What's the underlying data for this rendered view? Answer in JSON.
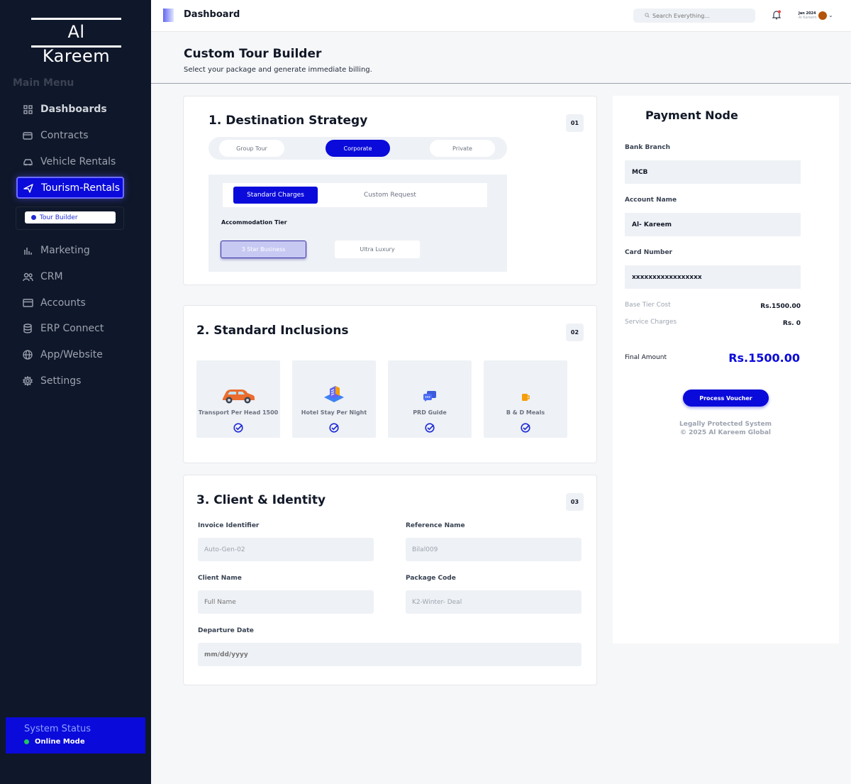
{
  "brand": "Al Kareem",
  "sidebar": {
    "menu_heading": "Main Menu",
    "items": [
      {
        "label": "Dashboards"
      },
      {
        "label": "Contracts"
      },
      {
        "label": "Vehicle Rentals"
      },
      {
        "label": "Tourism-Rentals"
      },
      {
        "label": "Marketing"
      },
      {
        "label": "CRM"
      },
      {
        "label": "Accounts"
      },
      {
        "label": "ERP Connect"
      },
      {
        "label": "App/Website"
      },
      {
        "label": "Settings"
      }
    ],
    "sub_item": "Tour Builder",
    "status_title": "System Status",
    "status_value": "Online Mode"
  },
  "topbar": {
    "title": "Dashboard",
    "search_placeholder": "Search Everything...",
    "user_date": "Jan 2024",
    "user_name": "Al Kareem"
  },
  "page": {
    "title": "Custom Tour Builder",
    "subtitle": "Select your package and generate immediate billing."
  },
  "destination": {
    "title": "1. Destination Strategy",
    "badge": "01",
    "modes": [
      "Group Tour",
      "Corporate",
      "Private"
    ],
    "tabs": [
      "Standard Charges",
      "Custom Request"
    ],
    "accommodation_label": "Accommodation Tier",
    "tiers": [
      "3 Star Business",
      "Ultra Luxury"
    ]
  },
  "inclusions": {
    "title": "2. Standard Inclusions",
    "badge": "02",
    "items": [
      {
        "label": "Transport Per Head 1500",
        "icon": "car-icon"
      },
      {
        "label": "Hotel Stay Per Night",
        "icon": "hotel-icon"
      },
      {
        "label": "PRD Guide",
        "icon": "guide-chat-icon"
      },
      {
        "label": "B & D Meals",
        "icon": "mug-icon"
      }
    ]
  },
  "client": {
    "title": "3. Client & Identity",
    "badge": "03",
    "invoice_label": "Invoice Identifier",
    "invoice_value": "Auto-Gen-02",
    "reference_label": "Reference Name",
    "reference_value": "Bilal009",
    "client_label": "Client Name",
    "client_placeholder": "Full Name",
    "package_label": "Package Code",
    "package_value": "K2-Winter- Deal",
    "departure_label": "Departure Date",
    "departure_placeholder": "mm/dd/yyyy"
  },
  "payment": {
    "title": "Payment Node",
    "bank_label": "Bank Branch",
    "bank_value": "MCB",
    "account_label": "Account Name",
    "account_value": "Al- Kareem",
    "card_label": "Card Number",
    "card_value": "xxxxxxxxxxxxxxxxx",
    "base_label": "Base Tier Cost",
    "base_value": "Rs.1500.00",
    "service_label": "Service Charges",
    "service_value": "Rs. 0",
    "final_label": "Final Amount",
    "final_value": "Rs.1500.00",
    "button": "Process Voucher",
    "legal_line1": "Legally Protected System",
    "legal_line2": "© 2025 Al Kareem Global"
  },
  "colors": {
    "sidebar_bg": "#0f172a",
    "accent": "#0a0adb",
    "page_bg": "#f6f7f9",
    "field_bg": "#eef1f5",
    "online": "#22c55e"
  }
}
